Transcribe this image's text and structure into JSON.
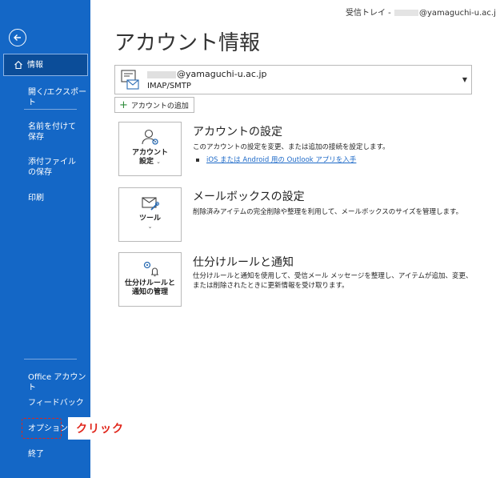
{
  "header": {
    "inbox_prefix": "受信トレイ - ",
    "inbox_suffix": "@yamaguchi-u.ac.jp  -"
  },
  "sidebar": {
    "back_icon": "back-arrow-icon",
    "info_label": "情報",
    "open_export_label": "開く/エクスポート",
    "save_as_label": "名前を付けて保存",
    "save_attachments_label": "添付ファイルの保存",
    "print_label": "印刷",
    "office_account_label": "Office アカウント",
    "feedback_label": "フィードバック",
    "options_label": "オプション",
    "exit_label": "終了"
  },
  "annotation": {
    "click_label": "クリック",
    "color": "#e0261b"
  },
  "main": {
    "title": "アカウント情報",
    "account": {
      "email_suffix": "@yamaguchi-u.ac.jp",
      "protocol": "IMAP/SMTP"
    },
    "add_account_label": "アカウントの追加",
    "sections": [
      {
        "tile_line1": "アカウント",
        "tile_line2": "設定",
        "title": "アカウントの設定",
        "desc": "このアカウントの設定を変更、または追加の接続を設定します。",
        "link": "iOS または Android 用の Outlook アプリを入手"
      },
      {
        "tile_line1": "ツール",
        "title": "メールボックスの設定",
        "desc": "削除済みアイテムの完全削除や整理を利用して、メールボックスのサイズを管理します。"
      },
      {
        "tile_line1": "仕分けルールと",
        "tile_line2": "通知の管理",
        "title": "仕分けルールと通知",
        "desc": "仕分けルールと通知を使用して、受信メール メッセージを整理し、アイテムが追加、変更、または削除されたときに更新情報を受け取ります。"
      }
    ]
  },
  "colors": {
    "sidebar": "#1467c6",
    "sidebar_selected": "#0b4d99",
    "link": "#1e6ac8"
  }
}
